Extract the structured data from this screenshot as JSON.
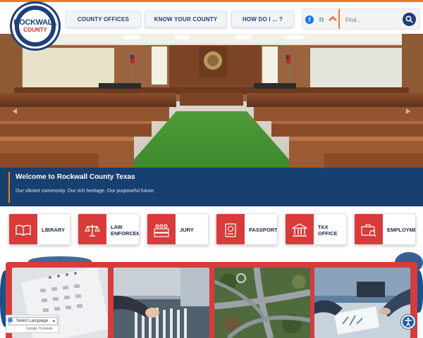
{
  "logo": {
    "line1": "ROCKWALL",
    "line2": "COUNTY"
  },
  "nav": [
    {
      "label": "COUNTY OFFICES"
    },
    {
      "label": "KNOW YOUR COUNTY"
    },
    {
      "label": "HOW DO I ... ?"
    }
  ],
  "search": {
    "placeholder": "Find..."
  },
  "welcome": {
    "title": "Welcome to Rockwall County Texas",
    "subtitle": "Our vibrant community. Our rich heritage. Our purposeful future."
  },
  "quick_links": [
    {
      "label": "LIBRARY",
      "icon": "book-icon"
    },
    {
      "label": "LAW\nENFORCEM",
      "icon": "scales-icon"
    },
    {
      "label": "JURY",
      "icon": "jury-icon"
    },
    {
      "label": "PASSPORT",
      "icon": "passport-icon"
    },
    {
      "label": "TAX\nOFFICE",
      "icon": "courthouse-icon"
    },
    {
      "label": "EMPLOYMEI",
      "icon": "briefcase-icon"
    }
  ],
  "translate": {
    "label": "Select Language",
    "powered": "Google Translate"
  },
  "colors": {
    "accent": "#f07c22",
    "navy": "#1e3f7a",
    "welcome_bg": "#173f6f",
    "quick_icon_bg": "#d93a3a"
  }
}
